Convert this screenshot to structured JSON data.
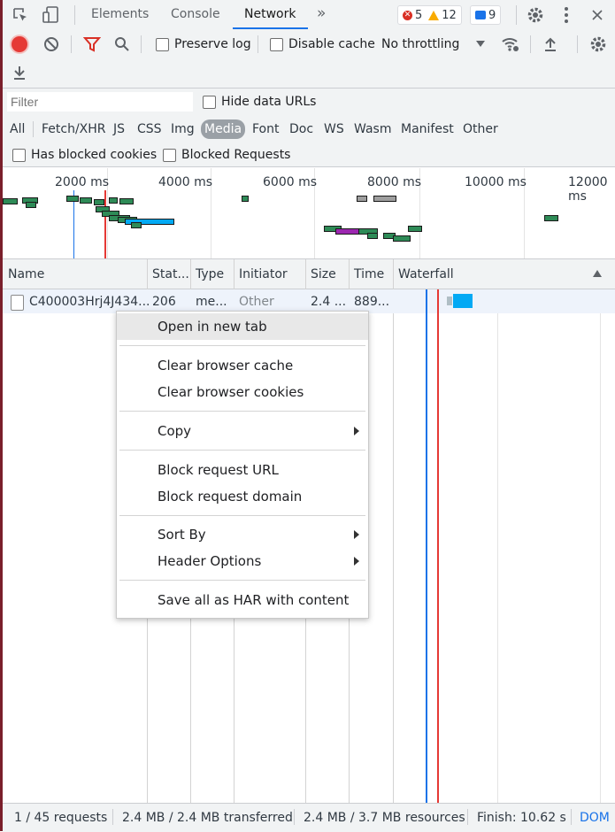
{
  "tabs": {
    "elements": "Elements",
    "console": "Console",
    "network": "Network",
    "more": "»"
  },
  "badges": {
    "errors": "5",
    "warnings": "12",
    "messages": "9"
  },
  "toolbar": {
    "preserve_log": "Preserve log",
    "disable_cache": "Disable cache",
    "throttling": "No throttling"
  },
  "filter": {
    "placeholder": "Filter",
    "hide_data_urls": "Hide data URLs",
    "types": [
      "All",
      "Fetch/XHR",
      "JS",
      "CSS",
      "Img",
      "Media",
      "Font",
      "Doc",
      "WS",
      "Wasm",
      "Manifest",
      "Other"
    ],
    "active_type": "Media",
    "has_blocked_cookies": "Has blocked cookies",
    "blocked_requests": "Blocked Requests"
  },
  "overview": {
    "ticks": [
      "2000 ms",
      "4000 ms",
      "6000 ms",
      "8000 ms",
      "10000 ms",
      "12000 ms"
    ]
  },
  "table": {
    "columns": [
      "Name",
      "Stat...",
      "Type",
      "Initiator",
      "Size",
      "Time",
      "Waterfall"
    ],
    "rows": [
      {
        "name": "C400003Hrj4J434...",
        "status": "206",
        "type": "me...",
        "initiator": "Other",
        "size": "2.4 ...",
        "time": "889..."
      }
    ]
  },
  "context_menu": {
    "open_new_tab": "Open in new tab",
    "clear_cache": "Clear browser cache",
    "clear_cookies": "Clear browser cookies",
    "copy": "Copy",
    "block_url": "Block request URL",
    "block_domain": "Block request domain",
    "sort_by": "Sort By",
    "header_options": "Header Options",
    "save_har": "Save all as HAR with content"
  },
  "status": {
    "requests": "1 / 45 requests",
    "transferred": "2.4 MB / 2.4 MB transferred",
    "resources": "2.4 MB / 3.7 MB resources",
    "finish": "Finish: 10.62 s",
    "dom": "DOM"
  },
  "colors": {
    "accent": "#1a73e8",
    "record": "#e53935",
    "filter_icon": "#d93025",
    "waterfall_bar": "#03a9f4"
  }
}
